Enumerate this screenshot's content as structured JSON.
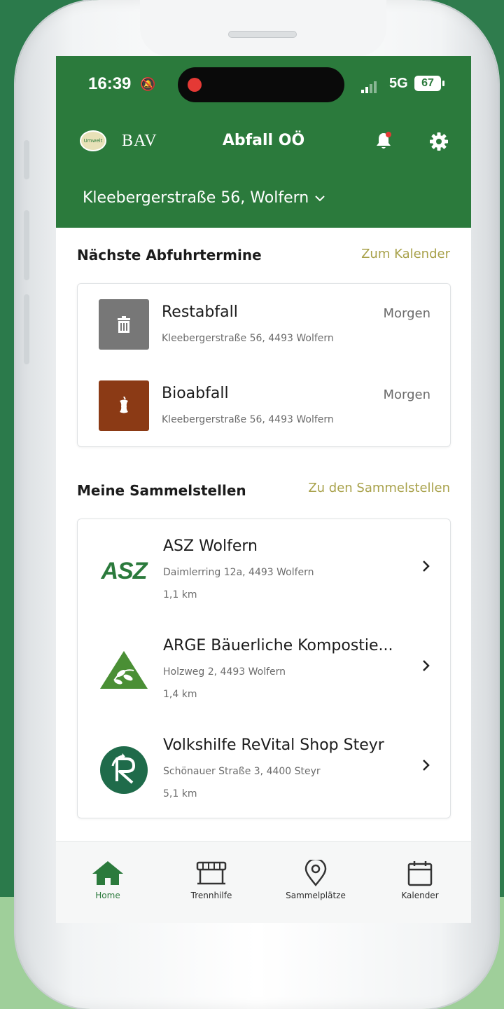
{
  "status_bar": {
    "time": "16:39",
    "network": "5G",
    "battery": "67"
  },
  "header": {
    "logo_small_text": "Umwelt Profis",
    "brand": "BAV",
    "title": "Abfall OÖ",
    "address": "Kleebergerstraße 56, Wolfern"
  },
  "pickups": {
    "title": "Nächste Abfuhrtermine",
    "link": "Zum Kalender",
    "items": [
      {
        "name": "Restabfall",
        "address": "Kleebergerstraße 56, 4493 Wolfern",
        "when": "Morgen",
        "color": "#777777",
        "icon": "trash-bin-icon"
      },
      {
        "name": "Bioabfall",
        "address": "Kleebergerstraße 56, 4493 Wolfern",
        "when": "Morgen",
        "color": "#8b3a15",
        "icon": "apple-core-icon"
      }
    ]
  },
  "stations": {
    "title": "Meine Sammelstellen",
    "link": "Zu den Sammelstellen",
    "items": [
      {
        "name": "ASZ Wolfern",
        "address": "Daimlerring 12a, 4493 Wolfern",
        "distance": "1,1 km",
        "logo_text": "ASZ"
      },
      {
        "name": "ARGE Bäuerliche Kompostie...",
        "address": "Holzweg 2, 4493 Wolfern",
        "distance": "1,4 km"
      },
      {
        "name": "Volkshilfe ReVital Shop Steyr",
        "address": "Schönauer Straße 3, 4400 Steyr",
        "distance": "5,1 km"
      }
    ]
  },
  "tabs": [
    {
      "label": "Home",
      "icon": "home-icon",
      "active": true
    },
    {
      "label": "Trennhilfe",
      "icon": "sorting-help-icon",
      "active": false
    },
    {
      "label": "Sammelplätze",
      "icon": "map-pin-icon",
      "active": false
    },
    {
      "label": "Kalender",
      "icon": "calendar-icon",
      "active": false
    }
  ],
  "colors": {
    "header_green": "#2b7a3c",
    "link_olive": "#a8a14a",
    "asz_green": "#2b7a3c"
  }
}
